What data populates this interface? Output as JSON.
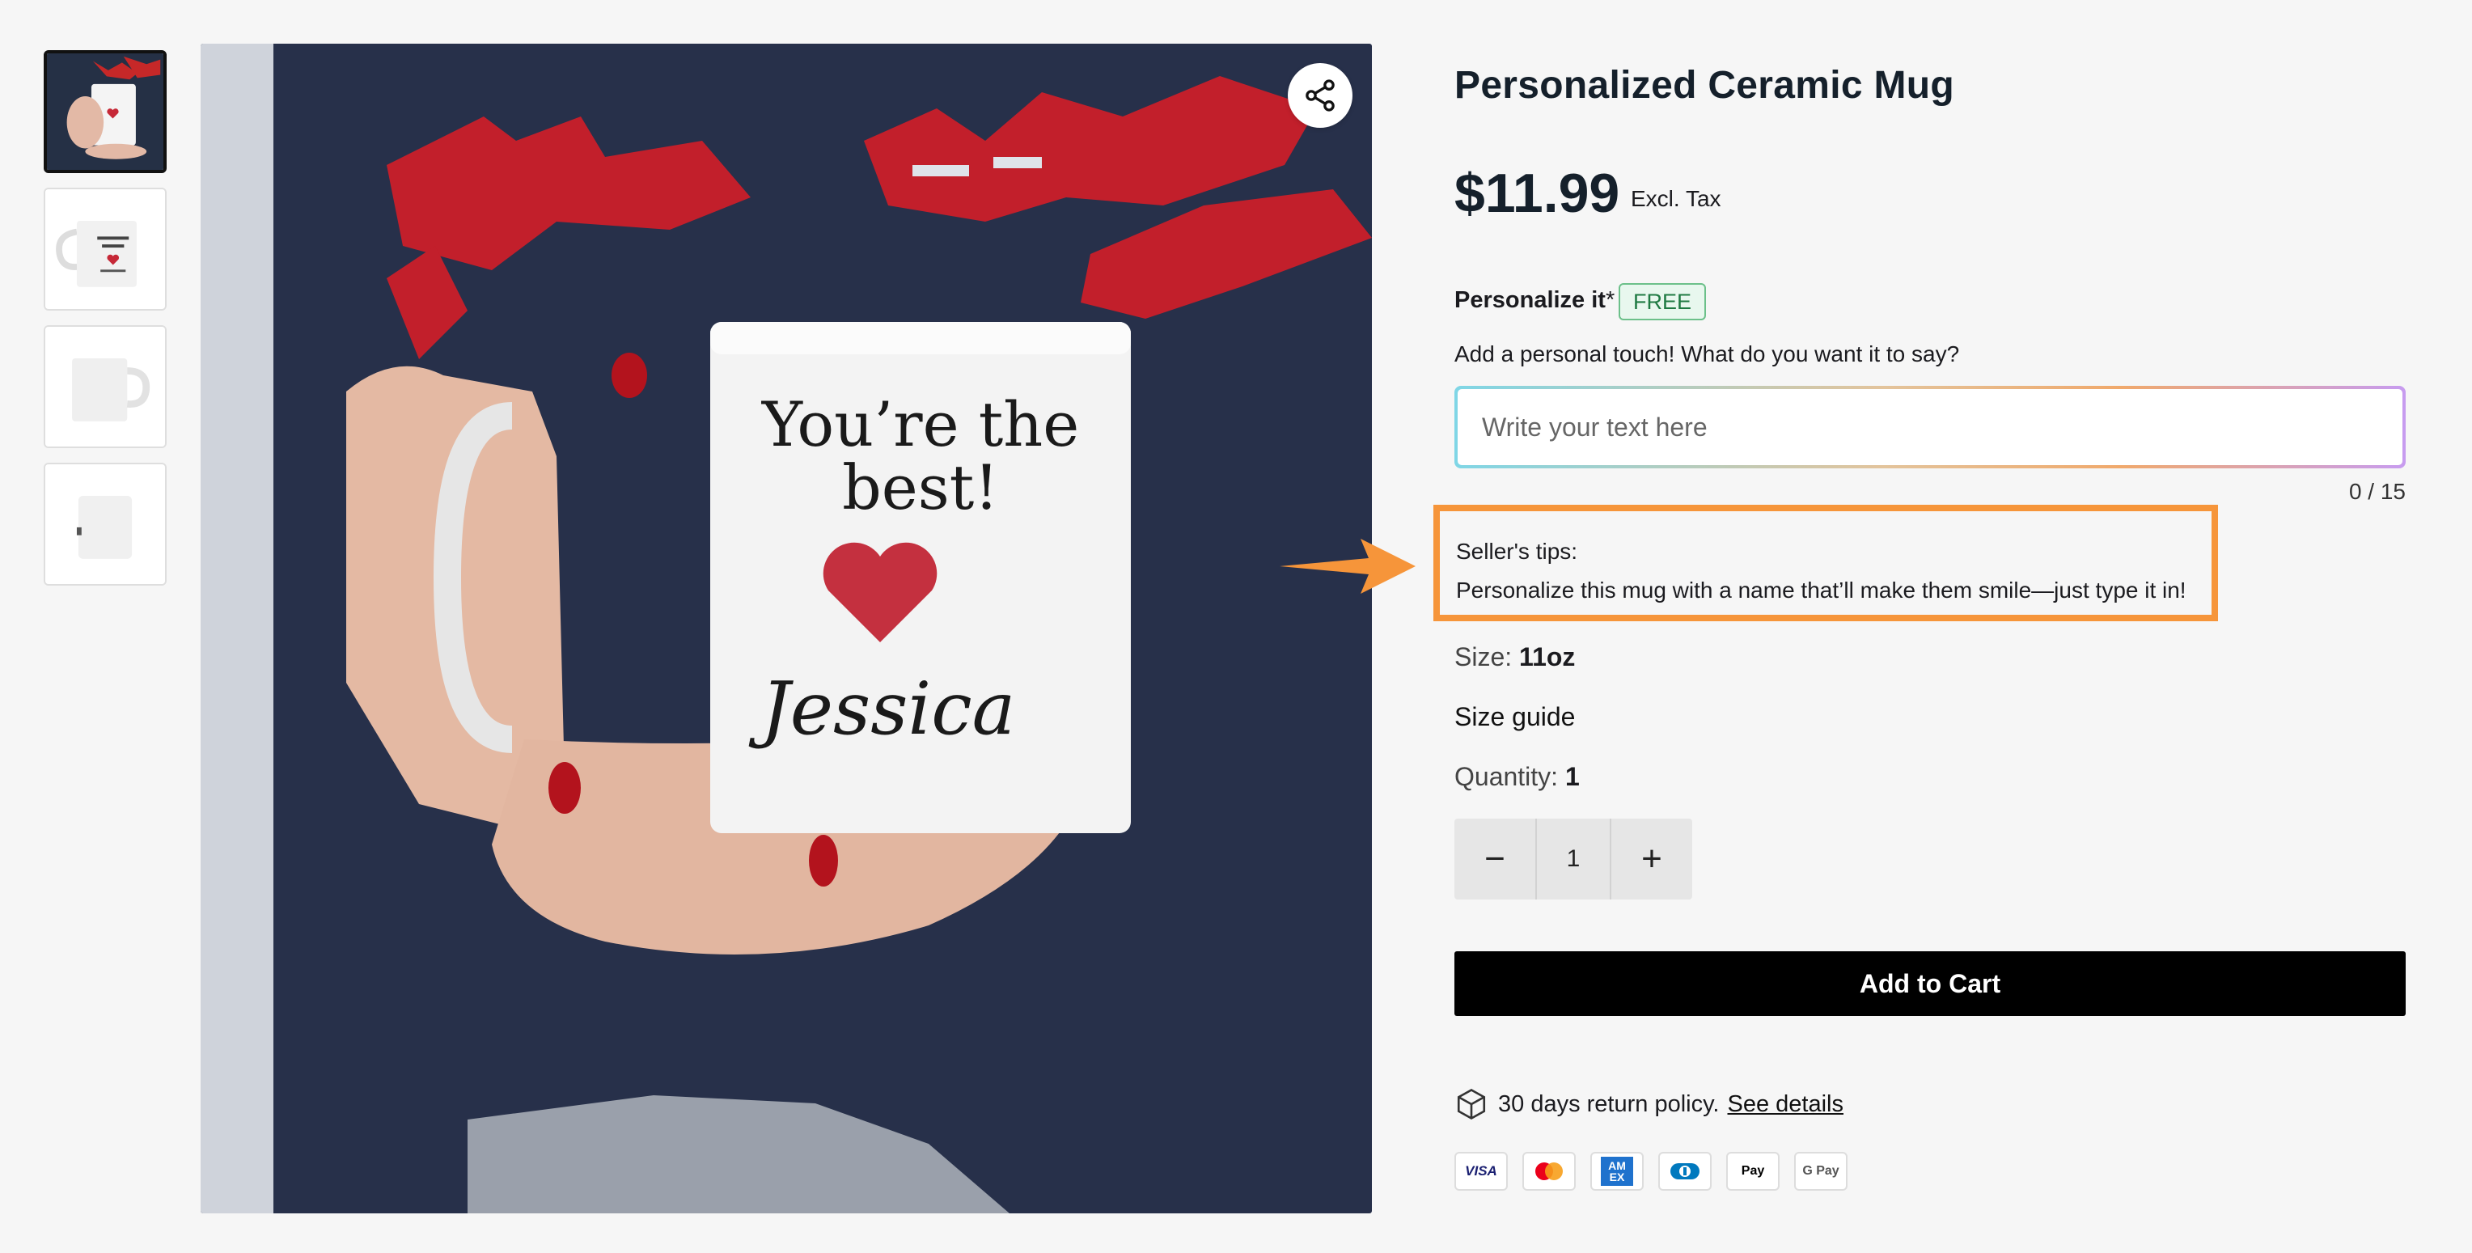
{
  "product": {
    "title": "Personalized Ceramic Mug",
    "price": "$11.99",
    "tax_note": "Excl. Tax"
  },
  "personalize": {
    "label": "Personalize it",
    "required_mark": "*",
    "badge": "FREE",
    "help": "Add a personal touch! What do you want it to say?",
    "placeholder": "Write your text here",
    "counter": "0 / 15"
  },
  "tips": {
    "heading": "Seller's tips:",
    "text": "Personalize this mug with a name that’ll make them smile—just type it in!"
  },
  "size": {
    "label": "Size:",
    "value": "11oz"
  },
  "size_guide": "Size guide",
  "quantity": {
    "label": "Quantity:",
    "value": "1",
    "stepper_value": "1",
    "minus": "−",
    "plus": "+"
  },
  "add_to_cart": "Add to Cart",
  "returns": {
    "text": "30 days return policy.",
    "link": "See details"
  },
  "payment_methods": [
    "VISA",
    "Mastercard",
    "AMEX",
    "Diners",
    "Apple Pay",
    "G Pay"
  ],
  "payment_labels": {
    "visa": "VISA",
    "amex": "AM EX",
    "applepay": " Pay",
    "gpay": "G Pay"
  },
  "mug_print": {
    "line1": "You’re the",
    "line2": "best!",
    "name": "Jessica"
  },
  "colors": {
    "accent": "#f6953a",
    "button": "#000000",
    "free_badge": "#1f7a43"
  }
}
